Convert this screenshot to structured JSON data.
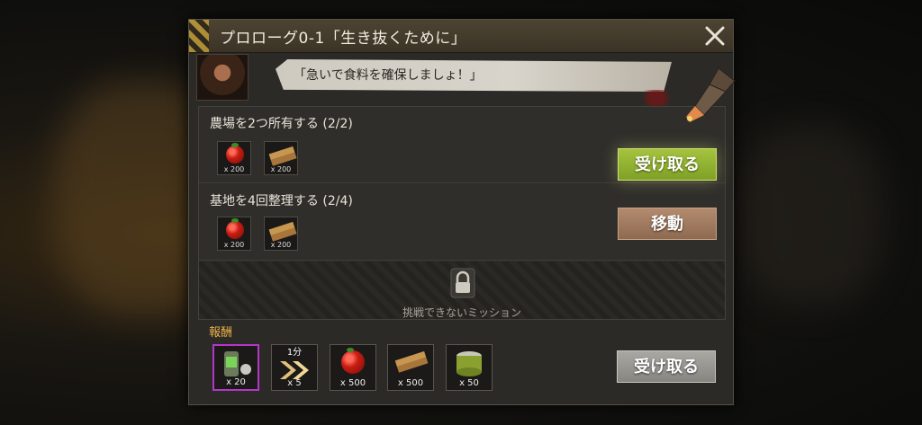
{
  "dialog": {
    "title": "プロローグ0-1「生き抜くために」",
    "speech": "「急いで食料を確保しましょ！」"
  },
  "missions": [
    {
      "title": "農場を2つ所有する (2/2)",
      "rewards": [
        {
          "icon": "tomato-icon",
          "qty": "x 200"
        },
        {
          "icon": "wood-plank-icon",
          "qty": "x 200"
        }
      ],
      "button_label": "受け取る"
    },
    {
      "title": "基地を4回整理する (2/4)",
      "rewards": [
        {
          "icon": "tomato-icon",
          "qty": "x 200"
        },
        {
          "icon": "wood-plank-icon",
          "qty": "x 200"
        }
      ],
      "button_label": "移動"
    }
  ],
  "locked_mission": {
    "text": "挑戦できないミッション"
  },
  "rewards": {
    "label": "報酬",
    "items": [
      {
        "icon": "battery-canister-icon",
        "qty": "x 20"
      },
      {
        "icon": "speedup-chevron-icon",
        "qty": "x 5",
        "top_label": "1分"
      },
      {
        "icon": "tomato-icon",
        "qty": "x 500"
      },
      {
        "icon": "wood-plank-icon",
        "qty": "x 500"
      },
      {
        "icon": "canned-food-icon",
        "qty": "x 50"
      }
    ],
    "claim_label": "受け取る"
  },
  "colors": {
    "claim_green": "#8fb030",
    "move_brown": "#a37c60",
    "reward_label": "#e8b14a",
    "selected_border": "#b436c8"
  }
}
